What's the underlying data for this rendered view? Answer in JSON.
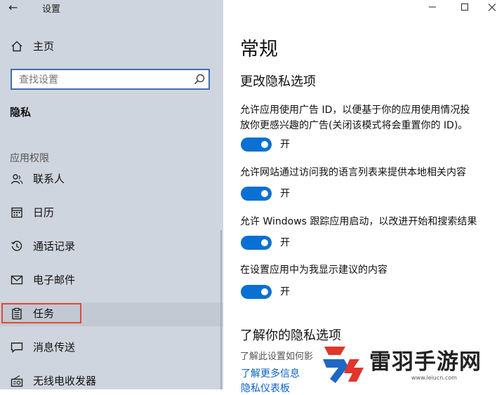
{
  "window": {
    "title": "设置",
    "controls": [
      "minimize-icon",
      "maximize-icon",
      "close-icon"
    ]
  },
  "sidebar": {
    "home_label": "主页",
    "search_placeholder": "查找设置",
    "privacy_heading": "隐私",
    "section_label": "应用权限",
    "items": [
      {
        "label": "联系人",
        "icon": "contacts-icon"
      },
      {
        "label": "日历",
        "icon": "calendar-icon"
      },
      {
        "label": "通话记录",
        "icon": "call-history-icon"
      },
      {
        "label": "电子邮件",
        "icon": "mail-icon"
      },
      {
        "label": "任务",
        "icon": "tasks-icon",
        "selected": true
      },
      {
        "label": "消息传送",
        "icon": "messaging-icon"
      },
      {
        "label": "无线电收发器",
        "icon": "radio-icon"
      }
    ]
  },
  "main": {
    "title": "常规",
    "subtitle": "更改隐私选项",
    "options": [
      {
        "desc_lines": [
          "允许应用使用广告 ID，以便基于你的应用使用情况投",
          "放你更感兴趣的广告(关闭该模式将会重置你的 ID)。"
        ],
        "state_label": "开",
        "on": true
      },
      {
        "desc_lines": [
          "允许网站通过访问我的语言列表来提供本地相关内容"
        ],
        "state_label": "开",
        "on": true
      },
      {
        "desc_lines": [
          "允许 Windows 跟踪应用启动，以改进开始和搜索结果"
        ],
        "state_label": "开",
        "on": true
      },
      {
        "desc_lines": [
          "在设置应用中为我显示建议的内容"
        ],
        "state_label": "开",
        "on": true
      }
    ],
    "learn_title": "了解你的隐私选项",
    "learn_desc": "了解此设置如何影",
    "learn_link": "了解更多信息",
    "privacy_dashboard_link": "隐私仪表板"
  },
  "watermark": {
    "name": "雷羽手游网",
    "url": "www.leiucn.com"
  },
  "colors": {
    "sidebar_bg": "#cfd5de",
    "accent": "#0a70d3",
    "search_border": "#3d6fb0",
    "highlight_frame": "#e2493a",
    "link": "#0b62c1",
    "watermark_red": "#e2352b",
    "watermark_blue": "#1f67c4"
  }
}
